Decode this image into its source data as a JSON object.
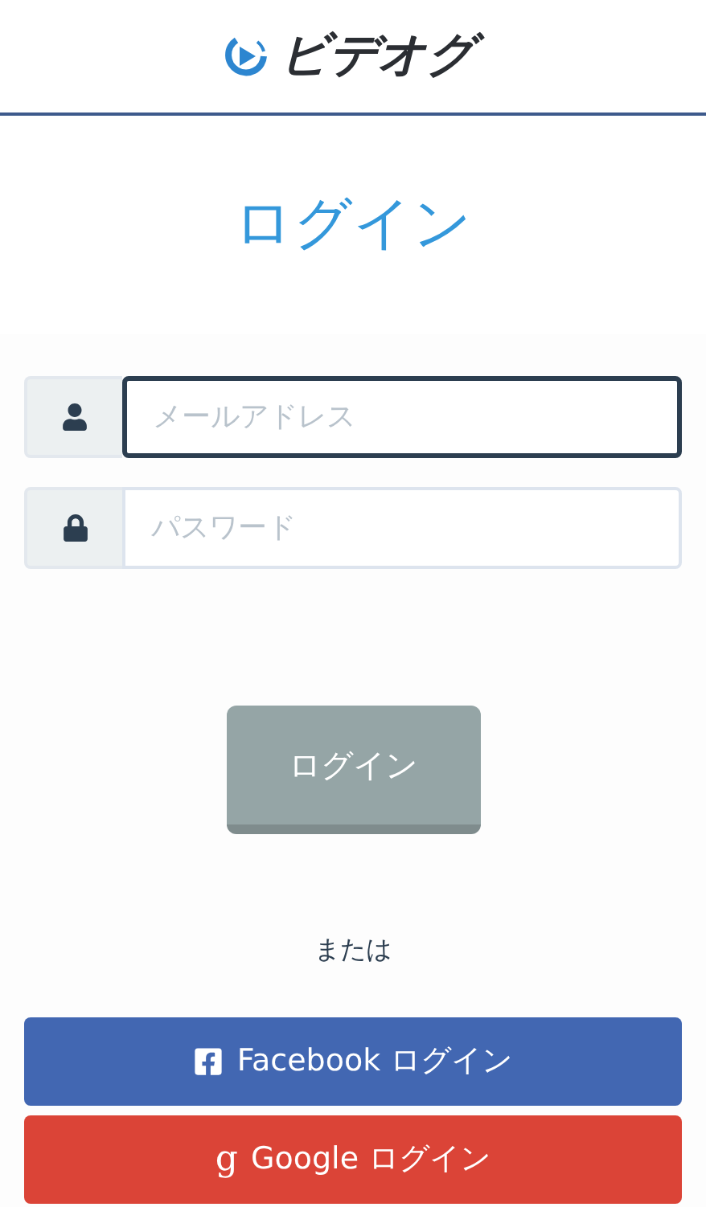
{
  "header": {
    "logo_text": "ビデオグ"
  },
  "title": "ログイン",
  "fields": [
    {
      "kind": "email",
      "placeholder": "メールアドレス",
      "focused": true
    },
    {
      "kind": "password",
      "placeholder": "パスワード",
      "focused": false
    }
  ],
  "login_button": {
    "label": "ログイン",
    "disabled": true
  },
  "separator": "または",
  "social_buttons": [
    {
      "kind": "facebook",
      "label": "Facebook ログイン",
      "color": "#4267b2"
    },
    {
      "kind": "google",
      "icon_char": "g",
      "label": "Google ログイン",
      "color": "#db4437"
    }
  ]
}
